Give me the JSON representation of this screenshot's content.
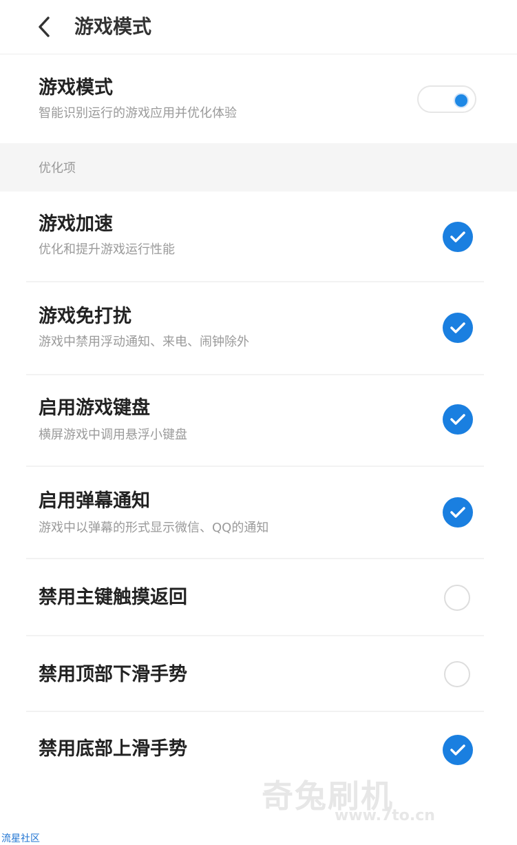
{
  "header": {
    "title": "游戏模式"
  },
  "game_mode": {
    "title": "游戏模式",
    "description": "智能识别运行的游戏应用并优化体验",
    "enabled": true
  },
  "section": {
    "label": "优化项"
  },
  "items": [
    {
      "title": "游戏加速",
      "description": "优化和提升游戏运行性能",
      "checked": true
    },
    {
      "title": "游戏免打扰",
      "description": "游戏中禁用浮动通知、来电、闹钟除外",
      "checked": true
    },
    {
      "title": "启用游戏键盘",
      "description": "横屏游戏中调用悬浮小键盘",
      "checked": true
    },
    {
      "title": "启用弹幕通知",
      "description": "游戏中以弹幕的形式显示微信、QQ的通知",
      "checked": true
    },
    {
      "title": "禁用主键触摸返回",
      "checked": false
    },
    {
      "title": "禁用顶部下滑手势",
      "checked": false
    },
    {
      "title": "禁用底部上滑手势",
      "checked": true
    }
  ],
  "watermark": {
    "brand": "奇兔刷机",
    "url": "www.7to.cn"
  },
  "corner_label": "流星社区",
  "colors": {
    "accent": "#1a7fe0"
  }
}
